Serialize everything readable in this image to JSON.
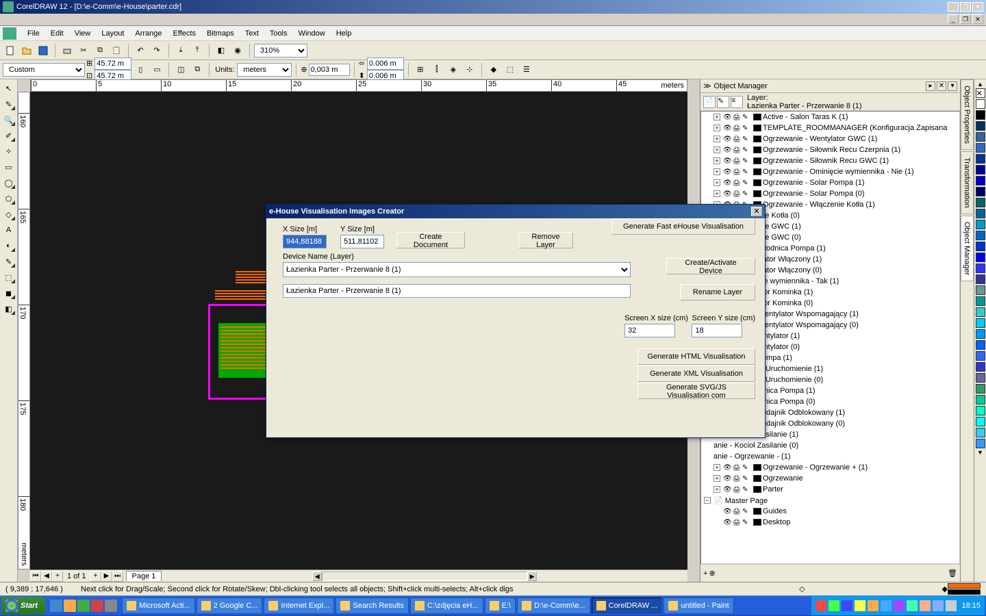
{
  "titlebar": {
    "text": "CorelDRAW 12 - [D:\\e-Comm\\e-House\\parter.cdr]"
  },
  "menu": {
    "file": "File",
    "edit": "Edit",
    "view": "View",
    "layout": "Layout",
    "arrange": "Arrange",
    "effects": "Effects",
    "bitmaps": "Bitmaps",
    "text": "Text",
    "tools": "Tools",
    "window": "Window",
    "help": "Help"
  },
  "toolbar": {
    "zoom": "310%"
  },
  "propbar": {
    "paper_preset": "Custom",
    "width": "45.72 m",
    "height": "45.72 m",
    "units_label": "Units:",
    "units_value": "meters",
    "nudge": "0,003 m",
    "dup_x": "0.006 m",
    "dup_y": "0.006 m"
  },
  "ruler": {
    "h": [
      "0",
      "5",
      "10",
      "15",
      "20",
      "25",
      "30",
      "35",
      "40",
      "45"
    ],
    "h_unit": "meters",
    "v": [
      "160",
      "165",
      "170",
      "175",
      "180"
    ],
    "v_unit": "meters"
  },
  "pagenav": {
    "label": "1 of 1",
    "tab": "Page 1"
  },
  "docker": {
    "title": "Object Manager",
    "layer_label": "Layer:",
    "layer_name": "Łazienka Parter - Przerwanie 8 (1)",
    "master": "Master Page",
    "guides": "Guides",
    "desktop": "Desktop",
    "layers": [
      "Active - Salon Taras K (1)",
      "TEMPLATE_ROOMMANAGER (Konfiguracja Zapisana",
      "Ogrzewanie - Wentylator GWC (1)",
      "Ogrzewanie - Siłownik Recu Czerpnia (1)",
      "Ogrzewanie - Siłownik Recu GWC (1)",
      "Ogrzewanie - Ominięcie wymiennika - Nie (1)",
      "Ogrzewanie - Solar Pompa (1)",
      "Ogrzewanie - Solar Pompa (0)",
      "Ogrzewanie - Włączenie Kotła (1)",
      "anie - Włączenie Kotła (0)",
      "anie - Włączenie GWC (1)",
      "anie - Włączenie GWC (0)",
      "anie - GWC Chłodnica Pompa (1)",
      "anie - Rekuperator Włączony (1)",
      "anie - Rekuperator Włączony (0)",
      "anie - Ominięcie wymiennika - Tak (1)",
      "anie - Wentylator Kominka (1)",
      "anie - Wentylator Kominka (0)",
      "anie - RECU Wentylator Wspomagający (1)",
      "anie - RECU Wentylator Wspomagający (0)",
      "anie - DGP Wentylator (1)",
      "anie - DGP Wentylator (0)",
      "anie - Kocioł Pompa (1)",
      "anie - Podajnik Uruchomienie (1)",
      "anie - Podajnik Uruchomienie (0)",
      "anie - Nagrzewnica Pompa (1)",
      "anie - Nagrzewnica Pompa (0)",
      "anie - Kocioł Podajnik Odblokowany (1)",
      "anie - Kocioł Podajnik Odblokowany (0)",
      "anie - Kocioł Zasilanie (1)",
      "anie - Kocioł Zasilanie (0)",
      "anie - Ogrzewanie - (1)",
      "Ogrzewanie - Ogrzewanie + (1)",
      "Ogrzewanie",
      "Parter"
    ]
  },
  "vtabs": {
    "obj_props": "Object Properties",
    "transform": "Transformation",
    "obj_mgr": "Object Manager"
  },
  "status": {
    "coords": "( 9,389 ; 17,646 )",
    "hint": "Next click for Drag/Scale; Second click for Rotate/Skew; Dbl-clicking tool selects all objects; Shift+click multi-selects; Alt+click digs"
  },
  "dialog": {
    "title": "e-House Visualisation Images Creator",
    "xsize_label": "X Size [m]",
    "xsize_value": "944,88188",
    "ysize_label": "Y Size [m]",
    "ysize_value": "511,81102",
    "create_doc": "Create Document",
    "remove_layer": "Remove Layer",
    "gen_fast": "Generate Fast eHouse Visualisation",
    "device_name_label": "Device Name (Layer)",
    "device_value": "Łazienka Parter - Przerwanie 8 (1)",
    "rename_value": "Łazienka Parter - Przerwanie 8 (1)",
    "create_activate": "Create/Activate Device",
    "rename_layer": "Rename Layer",
    "screen_x_label": "Screen X size (cm)",
    "screen_x_value": "32",
    "screen_y_label": "Screen Y size (cm)",
    "screen_y_value": "18",
    "gen_html": "Generate HTML Visualisation",
    "gen_xml": "Generate XML Visualisation",
    "gen_svg": "Generate SVG/JS Visualisation com"
  },
  "taskbar": {
    "start": "Start",
    "tasks": [
      {
        "label": "Microsoft Acti..."
      },
      {
        "label": "2 Google C..."
      },
      {
        "label": "Internet Expl..."
      },
      {
        "label": "Search Results"
      },
      {
        "label": "C:\\zdjęcia eH..."
      },
      {
        "label": "E:\\"
      },
      {
        "label": "D:\\e-Comm\\e..."
      },
      {
        "label": "CorelDRAW ...",
        "active": true
      },
      {
        "label": "untitled - Paint"
      }
    ],
    "clock": "18:15"
  },
  "colors": [
    "#ffffff",
    "#000000",
    "#003366",
    "#336699",
    "#3366cc",
    "#003399",
    "#000099",
    "#0000cc",
    "#000066",
    "#006666",
    "#006699",
    "#0099cc",
    "#0066cc",
    "#0033cc",
    "#0000ff",
    "#3333ff",
    "#333399",
    "#669999",
    "#009999",
    "#33cccc",
    "#00ccff",
    "#0099ff",
    "#0066ff",
    "#3366ff",
    "#3333cc",
    "#666699",
    "#339966",
    "#00cc99",
    "#00ffcc",
    "#00ffff",
    "#33ccff",
    "#3399ff"
  ]
}
